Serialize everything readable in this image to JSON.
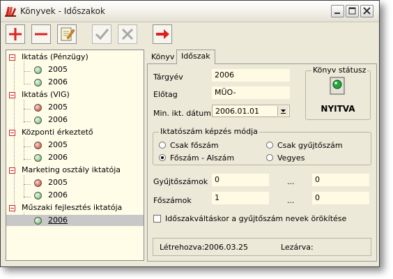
{
  "window": {
    "title": "Könyvek - Időszakok"
  },
  "toolbar": {
    "buttons": [
      {
        "name": "add",
        "icon": "plus-icon",
        "enabled": true
      },
      {
        "name": "delete",
        "icon": "minus-icon",
        "enabled": true
      },
      {
        "name": "edit",
        "icon": "edit-notepad-icon",
        "enabled": true
      },
      {
        "name": "confirm",
        "icon": "checkmark-icon",
        "enabled": false
      },
      {
        "name": "cancel",
        "icon": "x-icon",
        "enabled": false
      },
      {
        "name": "exit",
        "icon": "exit-arrow-icon",
        "enabled": true
      }
    ]
  },
  "tree": {
    "books": [
      {
        "label": "Iktatás (Pénzügy)",
        "periods": [
          {
            "label": "2005",
            "status": "green"
          },
          {
            "label": "2006",
            "status": "green"
          }
        ]
      },
      {
        "label": "Iktatás (VIG)",
        "periods": [
          {
            "label": "2005",
            "status": "red"
          },
          {
            "label": "2006",
            "status": "green"
          }
        ]
      },
      {
        "label": "Központi érkeztető",
        "periods": [
          {
            "label": "2005",
            "status": "red"
          },
          {
            "label": "2006",
            "status": "green"
          }
        ]
      },
      {
        "label": "Marketing osztály iktatója",
        "periods": [
          {
            "label": "2005",
            "status": "red"
          },
          {
            "label": "2006",
            "status": "green"
          }
        ]
      },
      {
        "label": "Műszaki fejlesztés iktatója",
        "periods": [
          {
            "label": "2006",
            "status": "green",
            "selected": true
          }
        ]
      }
    ]
  },
  "tabs": [
    {
      "label": "Könyv",
      "active": false
    },
    {
      "label": "Időszak",
      "active": true
    }
  ],
  "form": {
    "targyev_label": "Tárgyév",
    "targyev_value": "2006",
    "elotag_label": "Előtag",
    "elotag_value": "MÜO-",
    "min_datum_label": "Min. ikt. dátum",
    "min_datum_value": "2006.01.01"
  },
  "status_box": {
    "title": "Könyv státusz",
    "value": "NYITVA",
    "led_color": "#1fa83a"
  },
  "numbering_group": {
    "title": "Iktatószám képzés módja",
    "options": [
      {
        "label": "Csak főszám",
        "checked": false
      },
      {
        "label": "Csak gyűjtőszám",
        "checked": false
      },
      {
        "label": "Főszám - Alszám",
        "checked": true
      },
      {
        "label": "Vegyes",
        "checked": false
      }
    ]
  },
  "ranges": {
    "gyujto_label": "Gyűjtőszámok",
    "gyujto_from": "0",
    "gyujto_to": "0",
    "fo_label": "Főszámok",
    "fo_from": "1",
    "fo_to": "0",
    "separator": "..."
  },
  "inherit_checkbox": {
    "label": "Időszakváltáskor a gyűjtőszám nevek örökítése",
    "checked": false
  },
  "footer": {
    "created_label": "Létrehozva:",
    "created_value": "2006.03.25",
    "closed_label": "Lezárva:",
    "closed_value": ""
  }
}
